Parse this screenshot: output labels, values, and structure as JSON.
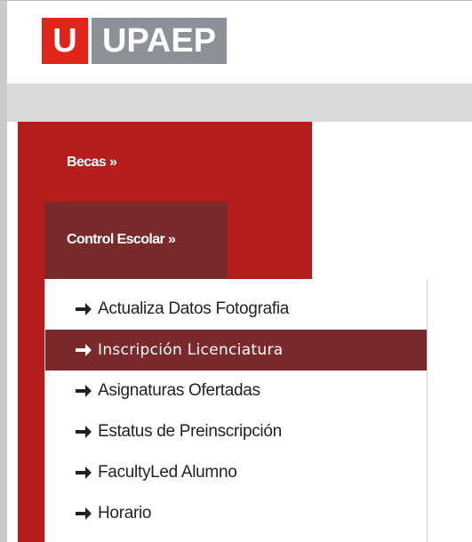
{
  "brand": {
    "logo_letter": "U",
    "logo_word": "UPAEP",
    "red": "#e1251b",
    "gray": "#8c9198"
  },
  "colors": {
    "sidebar": "#b71c1c",
    "active": "#7a2a2a",
    "topbar": "#d9d9d9"
  },
  "sidebar": {
    "items": [
      {
        "label": "Becas »"
      },
      {
        "label": "Control Escolar »",
        "expanded": true
      }
    ]
  },
  "dropdown": {
    "icon": "right-arrow-icon",
    "items": [
      {
        "label": "Actualiza Datos Fotografia",
        "active": false
      },
      {
        "label": "Inscripción Licenciatura",
        "active": true
      },
      {
        "label": "Asignaturas Ofertadas",
        "active": false
      },
      {
        "label": "Estatus de Preinscripción",
        "active": false
      },
      {
        "label": "FacultyLed Alumno",
        "active": false
      },
      {
        "label": "Horario",
        "active": false
      }
    ]
  }
}
